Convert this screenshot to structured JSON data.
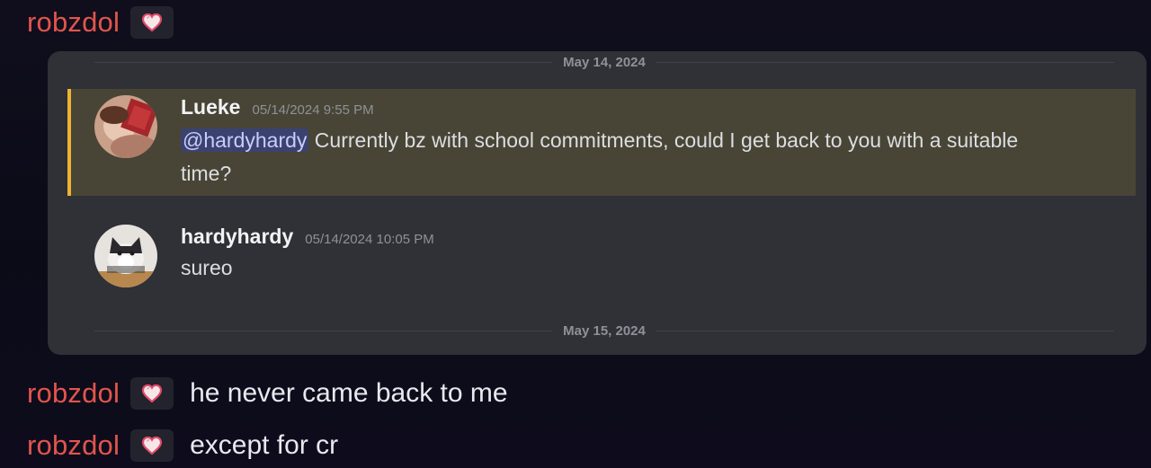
{
  "messages": [
    {
      "username": "robzdol",
      "badge": "heart-icon",
      "text": ""
    },
    {
      "username": "robzdol",
      "badge": "heart-icon",
      "text": "he never came back to me"
    },
    {
      "username": "robzdol",
      "badge": "heart-icon",
      "text": "except for cr"
    }
  ],
  "embed": {
    "date_top": "May 14, 2024",
    "date_bottom": "May 15, 2024",
    "quoted": [
      {
        "author": "Lueke",
        "timestamp": "05/14/2024 9:55 PM",
        "mention": "@hardyhardy",
        "text": " Currently bz with school commitments, could I get back to you with a suitable time?"
      },
      {
        "author": "hardyhardy",
        "timestamp": "05/14/2024 10:05 PM",
        "text": "sureo"
      }
    ]
  },
  "colors": {
    "username": "#e2554d",
    "highlight_bar": "#f0b232",
    "highlight_bg": "#484536",
    "mention_bg": "#3c4270"
  }
}
